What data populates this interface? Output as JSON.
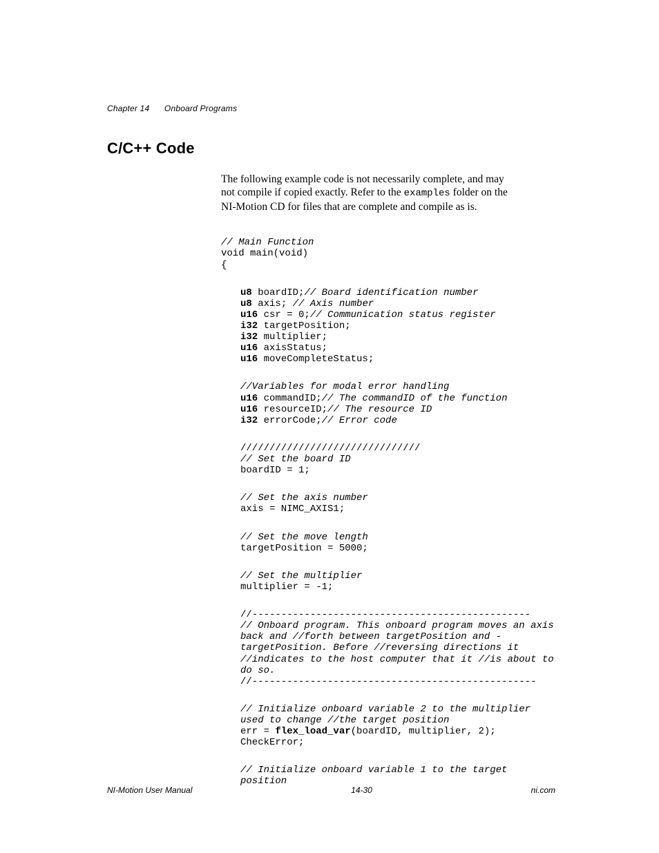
{
  "header": {
    "chapter": "Chapter 14",
    "title": "Onboard Programs"
  },
  "section_title": "C/C++ Code",
  "intro": {
    "l1": "The following example code is not necessarily complete, and may",
    "l2a": "not compile if copied exactly. Refer to the ",
    "l2b": "examples",
    "l2c": " folder on the",
    "l3": "NI-Motion CD for files that are complete and compile as is."
  },
  "code": {
    "c1a": "// Main Function",
    "c1b": "void main(void)",
    "c1c": "{",
    "d1a_b": "u8",
    "d1a_t": " boardID;",
    "d1a_c": "// Board identification number",
    "d1b_b": "u8",
    "d1b_t": " axis; ",
    "d1b_c": "// Axis number",
    "d1c_b": "u16",
    "d1c_t": " csr = 0;",
    "d1c_c": "// Communication status register",
    "d1d_b": "i32",
    "d1d_t": " targetPosition;",
    "d1e_b": "i32",
    "d1e_t": " multiplier;",
    "d1f_b": "u16",
    "d1f_t": " axisStatus;",
    "d1g_b": "u16",
    "d1g_t": " moveCompleteStatus;",
    "d2a_c": "//Variables for modal error handling",
    "d2b_b": "u16",
    "d2b_t": " commandID;",
    "d2b_c": "// The commandID of the function",
    "d2c_b": "u16",
    "d2c_t": " resourceID;",
    "d2c_c": "// The resource ID",
    "d2d_b": "i32",
    "d2d_t": " errorCode;",
    "d2d_c": "// Error code",
    "d3a": "///////////////////////////////",
    "d3b": "// Set the board ID",
    "d3c": "boardID = 1;",
    "d4a": "// Set the axis number",
    "d4b": "axis = NIMC_AXIS1;",
    "d5a": "// Set the move length",
    "d5b": "targetPosition = 5000;",
    "d6a": "// Set the multiplier",
    "d6b": "multiplier = -1;",
    "d7a": "//------------------------------------------------",
    "d7b": "// Onboard program. This onboard program moves an axis back and //forth between targetPosition and -targetPosition. Before //reversing directions it //indicates to the host computer that it //is about to do so.",
    "d7c": "//-------------------------------------------------",
    "d8a": "// Initialize onboard variable 2 to the multiplier used to change //the target position",
    "d8b_a": "err = ",
    "d8b_b": "flex_load_var",
    "d8b_c": "(boardID, multiplier, 2);",
    "d8c": "CheckError;",
    "d9a": "// Initialize onboard variable 1 to the target position"
  },
  "footer": {
    "left": "NI-Motion User Manual",
    "center": "14-30",
    "right": "ni.com"
  }
}
